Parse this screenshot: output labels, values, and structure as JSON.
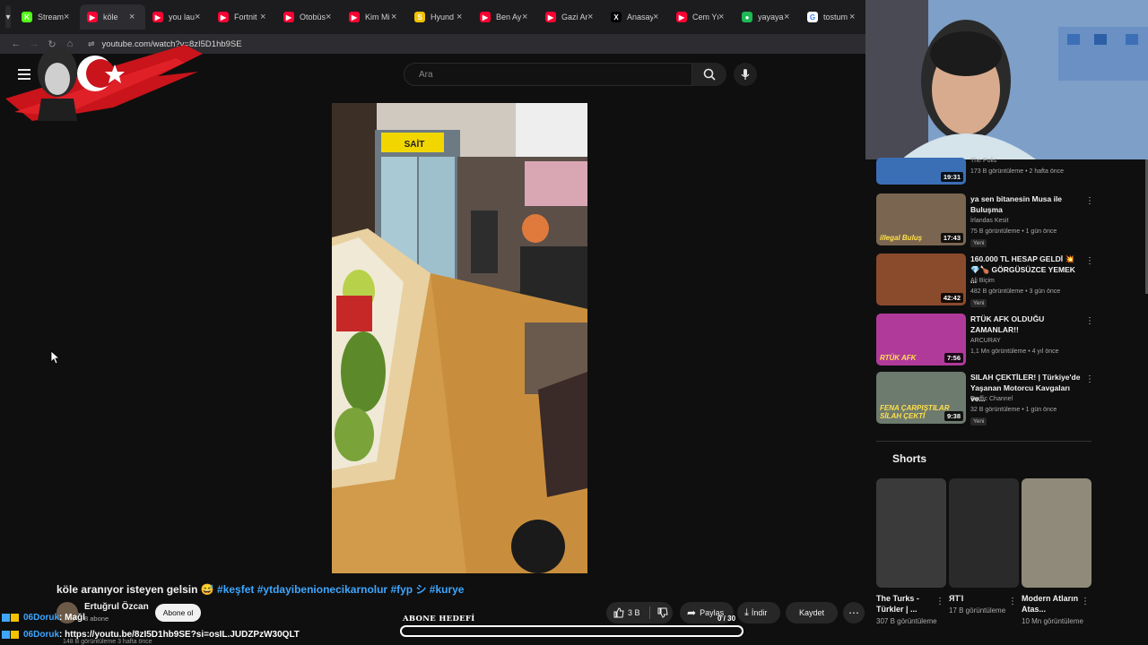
{
  "browser": {
    "tabs": [
      {
        "label": "Stream",
        "fav": "K",
        "color": "#53fc18",
        "active": false
      },
      {
        "label": "köle",
        "fav": "▶",
        "color": "#ff0033",
        "active": true
      },
      {
        "label": "you lau",
        "fav": "▶",
        "color": "#ff0033",
        "active": false
      },
      {
        "label": "Fortnit",
        "fav": "▶",
        "color": "#ff0033",
        "active": false
      },
      {
        "label": "Otobüs",
        "fav": "▶",
        "color": "#ff0033",
        "active": false
      },
      {
        "label": "Kim Mi",
        "fav": "▶",
        "color": "#ff0033",
        "active": false
      },
      {
        "label": "Hyund",
        "fav": "S",
        "color": "#f2c200",
        "active": false
      },
      {
        "label": "Ben Ay",
        "fav": "▶",
        "color": "#ff0033",
        "active": false
      },
      {
        "label": "Gazi Ar",
        "fav": "▶",
        "color": "#ff0033",
        "active": false
      },
      {
        "label": "Anasay",
        "fav": "X",
        "color": "#000000",
        "active": false
      },
      {
        "label": "Cem Yı",
        "fav": "▶",
        "color": "#ff0033",
        "active": false
      },
      {
        "label": "yayaya",
        "fav": "●",
        "color": "#1db954",
        "active": false
      },
      {
        "label": "tostum",
        "fav": "G",
        "color": "#ffffff",
        "active": false
      }
    ],
    "url": "youtube.com/watch?v=8zI5D1hb9SE"
  },
  "header": {
    "search_placeholder": "Ara"
  },
  "video": {
    "title_text": "köle aranıyor isteyen gelsin 😅",
    "hashtags": "#keşfet #ytdayibenionecikarnolur #fyp シ #kurye",
    "channel_name": "Ertuğrul Özcan",
    "channel_subs": "8 abone",
    "subscribe_label": "Abone ol",
    "likes": "3 B",
    "share_label": "Paylaş",
    "download_label": "İndir",
    "save_label": "Kaydet"
  },
  "stream_overlay": {
    "goal_label": "ABONE HEDEFİ",
    "goal_count": "0 / 30",
    "goal_progress": 0,
    "chat": [
      {
        "user": "06Doruk",
        "message": ": Mağl"
      },
      {
        "user": "06Doruk",
        "message": ": https://youtu.be/8zI5D1hb9SE?si=osIL.JUDZPzW30QLT"
      }
    ],
    "chat_sub": "148 B görüntüleme  3 hafta önce"
  },
  "sidebar": {
    "recommendations": [
      {
        "title": "",
        "channel": "The Polis",
        "meta": "173 B görüntüleme • 2 hafta önce",
        "duration": "19:31",
        "new_badge": "",
        "thumb_color": "#3b6fb5"
      },
      {
        "title": "ya sen bitanesin Musa ile Buluşma",
        "channel": "İrlandas Kesit",
        "meta": "75 B görüntüleme • 1 gün önce",
        "duration": "17:43",
        "new_badge": "Yeni",
        "thumb_color": "#7a6550",
        "thumb_text": "illegal Buluş"
      },
      {
        "title": "160.000 TL HESAP GELDİ 💥💎🍗 GÖRGÜSÜZCE YEMEK ...",
        "channel": "Ali Biçim",
        "meta": "482 B görüntüleme • 3 gün önce",
        "duration": "42:42",
        "new_badge": "Yeni",
        "thumb_color": "#8a4b2c"
      },
      {
        "title": "RTÜK AFK OLDUĞU ZAMANLAR!!",
        "channel": "ARCURAY",
        "meta": "1,1 Mn görüntüleme • 4 yıl önce",
        "duration": "7:56",
        "new_badge": "",
        "thumb_color": "#b03a9a",
        "thumb_text": "RTÜK AFK"
      },
      {
        "title": "SILAH ÇEKTİLER! | Türkiye'de Yaşanan Motorcu Kavgaları ve...",
        "channel": "Traffic Channel",
        "meta": "32 B görüntüleme • 1 gün önce",
        "duration": "9:38",
        "new_badge": "Yeni",
        "thumb_color": "#6d7a6e",
        "thumb_text": "FENA ÇARPIŞTILAR SİLAH ÇEKTİ"
      }
    ],
    "shorts_heading": "Shorts",
    "shorts": [
      {
        "title": "The Turks - Türkler | ...",
        "views": "307 B görüntüleme",
        "thumb_color": "#3a3a3a"
      },
      {
        "title": "ЯТΊ",
        "views": "17 B görüntüleme",
        "thumb_color": "#2a2a2a"
      },
      {
        "title": "Modern Atların Atas...",
        "views": "10 Mn görüntüleme",
        "thumb_color": "#8f8a7a"
      }
    ]
  }
}
